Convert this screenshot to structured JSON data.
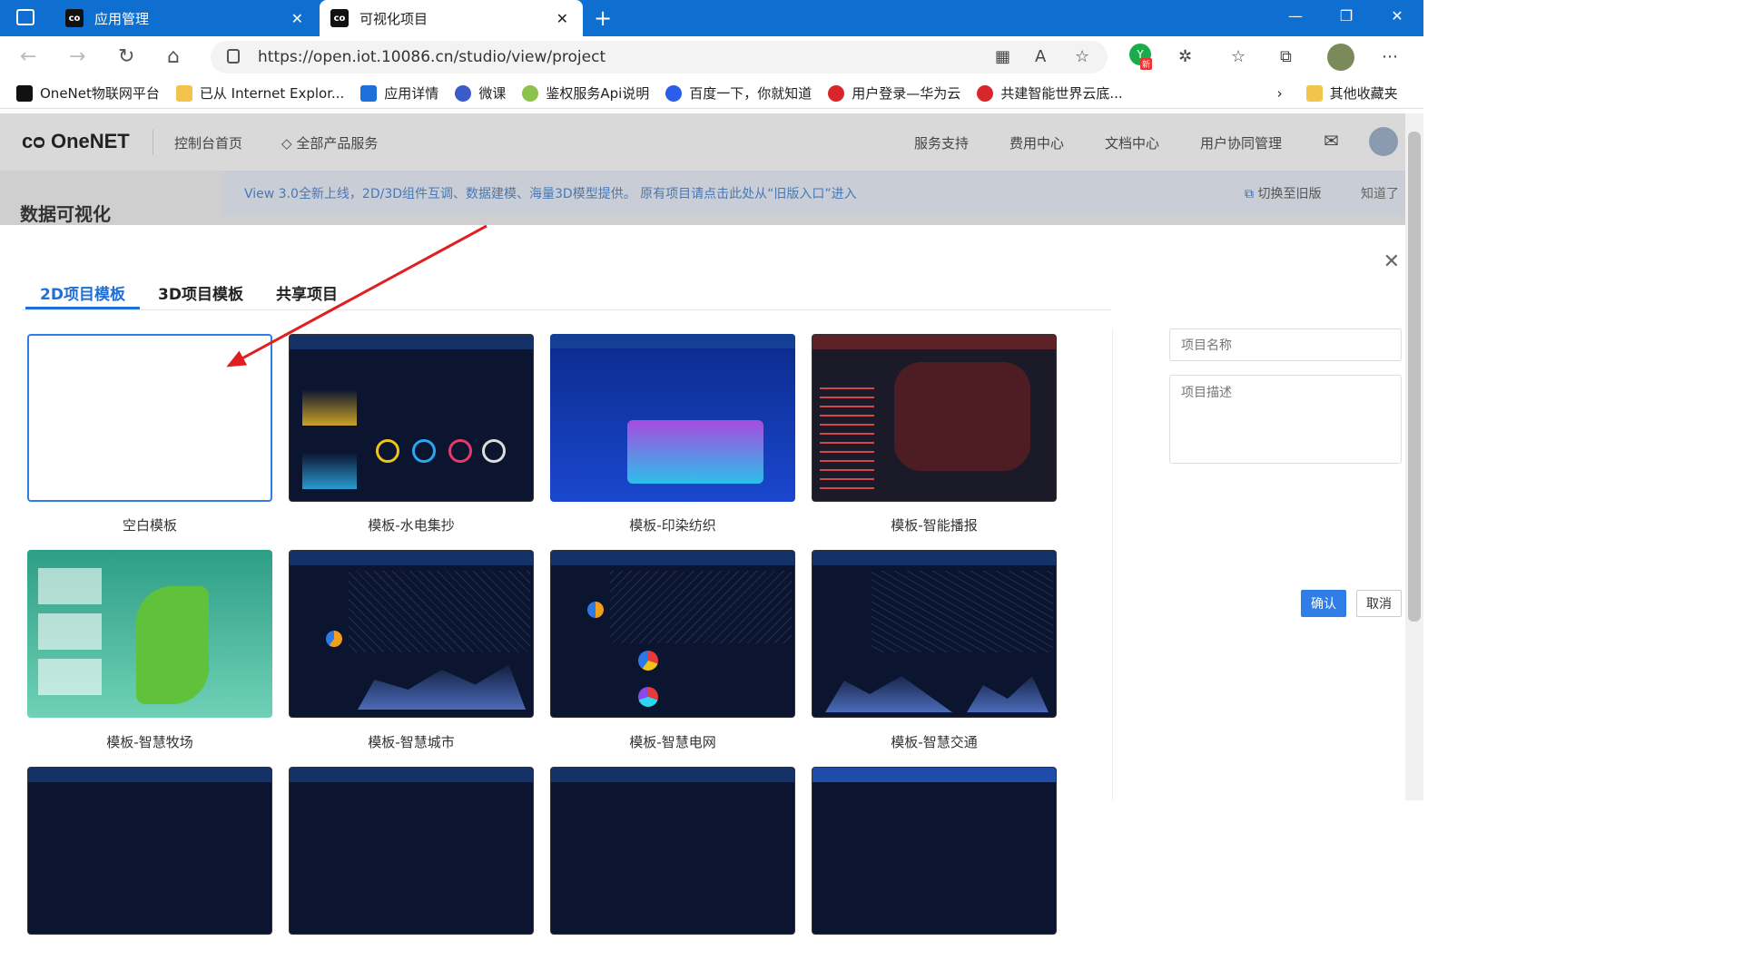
{
  "browser": {
    "tabs": [
      {
        "label": "应用管理"
      },
      {
        "label": "可视化项目"
      }
    ],
    "url": "https://open.iot.10086.cn/studio/view/project",
    "bookmarks": [
      "OneNet物联网平台",
      "已从 Internet Explor...",
      "应用详情",
      "微课",
      "鉴权服务Api说明",
      "百度一下，你就知道",
      "用户登录—华为云",
      "共建智能世界云底..."
    ],
    "other_bookmarks": "其他收藏夹",
    "profile_badge": "新"
  },
  "header": {
    "logo": "OneNET",
    "nav": [
      "控制台首页",
      "全部产品服务"
    ],
    "right_nav": [
      "服务支持",
      "费用中心",
      "文档中心",
      "用户协同管理"
    ]
  },
  "notice": {
    "text": "View 3.0全新上线，2D/3D组件互调、数据建模、海量3D模型提供。 原有项目请点击此处从“旧版入口”进入",
    "switch": "切换至旧版",
    "dismiss": "知道了"
  },
  "page_title": "数据可视化",
  "modal": {
    "tabs": [
      "2D项目模板",
      "3D项目模板",
      "共享项目"
    ],
    "templates": [
      "空白模板",
      "模板-水电集抄",
      "模板-印染纺织",
      "模板-智能播报",
      "模板-智慧牧场",
      "模板-智慧城市",
      "模板-智慧电网",
      "模板-智慧交通"
    ],
    "form": {
      "name_placeholder": "项目名称",
      "desc_placeholder": "项目描述",
      "confirm": "确认",
      "cancel": "取消"
    }
  },
  "colors": {
    "accent": "#2f7ee8",
    "titlebar": "#0f6fd0",
    "arrow": "#e02020"
  }
}
